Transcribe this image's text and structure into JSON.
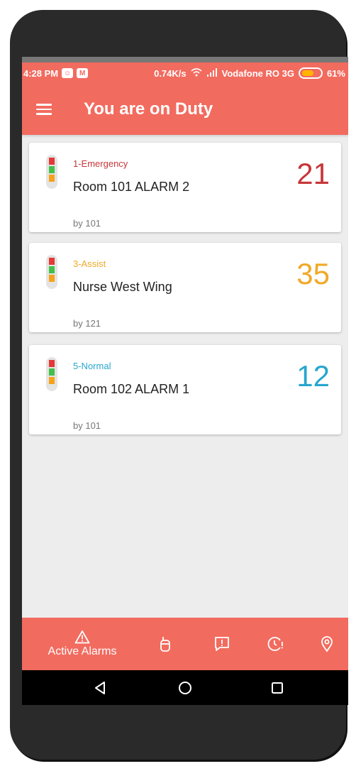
{
  "status_bar": {
    "time": "4:28 PM",
    "network_speed": "0.74K/s",
    "carrier": "Vodafone RO 3G",
    "battery": "61%"
  },
  "app_bar": {
    "title": "You are on Duty"
  },
  "alarms": [
    {
      "priority": "1-Emergency",
      "title": "Room 101 ALARM 2",
      "by": "by 101",
      "count": "21",
      "color": "#c6373a"
    },
    {
      "priority": "3-Assist",
      "title": "Nurse West Wing",
      "by": "by 121",
      "count": "35",
      "color": "#f0a928"
    },
    {
      "priority": "5-Normal",
      "title": "Room 102 ALARM 1",
      "by": "by 101",
      "count": "12",
      "color": "#27a6cf"
    }
  ],
  "bottom_nav": {
    "active_alarms_label": "Active Alarms"
  },
  "colors": {
    "primary": "#f26b5f",
    "signal_red": "#e53935",
    "signal_green": "#43c04a",
    "signal_orange": "#f7a21b"
  }
}
